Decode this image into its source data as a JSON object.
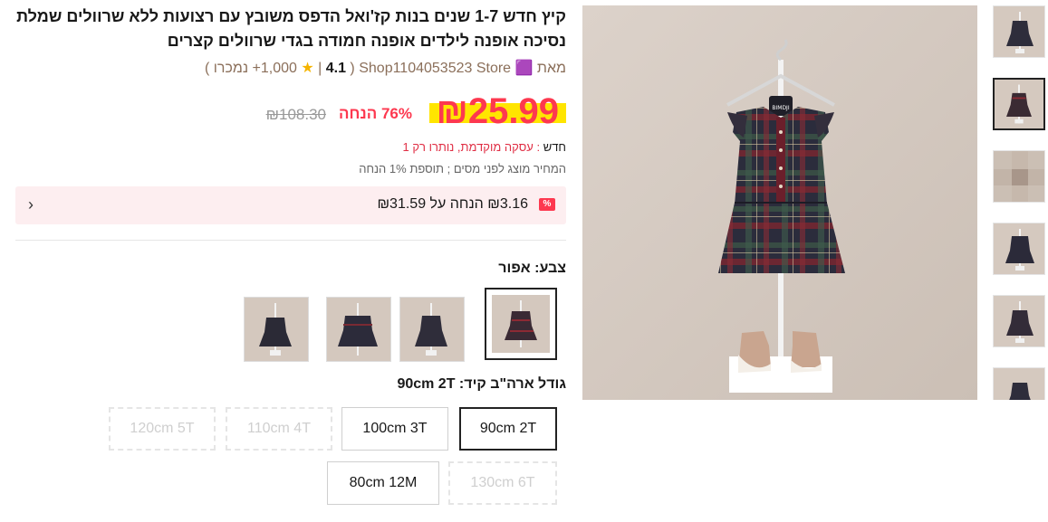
{
  "product": {
    "title": "קיץ חדש 1-7 שנים בנות קז'ואל הדפס משובץ עם רצועות ללא שרוולים שמלת נסיכה אופנה לילדים אופנה חמודה בגדי שרוולים קצרים",
    "store_prefix": "מאת",
    "store_name": "Shop1104053523 Store",
    "rating": "4.1",
    "sold": "1,000",
    "sold_suffix": "+ נמכרו",
    "store_line_text": "מאת Shop1104053523 Store ( 1,000 | 4.1+ נמכרו )"
  },
  "pricing": {
    "price": "₪25.99",
    "discount": "76% הנחה",
    "old_price": "₪108.30",
    "sale_badge": "חדש",
    "sale_text": "עסקה מוקדמת, נותרו רק 1",
    "tax_note": "המחיר מוצג לפני מסים ; תוספת 1% הנחה"
  },
  "coupon": {
    "icon_text": "%",
    "text": "₪3.16 הנחה על ₪31.59",
    "chevron": "‹"
  },
  "color": {
    "label": "צבע: אפור",
    "swatch_count": 4,
    "selected_index": 0
  },
  "size": {
    "label": "גודל ארה\"ב קיד: 90cm 2T",
    "options": [
      {
        "label": "90cm 2T",
        "state": "selected"
      },
      {
        "label": "100cm 3T",
        "state": "available"
      },
      {
        "label": "110cm 4T",
        "state": "disabled"
      },
      {
        "label": "120cm 5T",
        "state": "disabled"
      },
      {
        "label": "130cm 6T",
        "state": "disabled"
      },
      {
        "label": "80cm 12M",
        "state": "available"
      }
    ]
  },
  "gallery": {
    "hanger_tag": "BIMDJI",
    "thumbnail_count": 6,
    "active_thumbnail": 1
  },
  "colors": {
    "accent": "#fd384f",
    "price_highlight": "#ffe500",
    "store_text": "#8b6f5a"
  }
}
